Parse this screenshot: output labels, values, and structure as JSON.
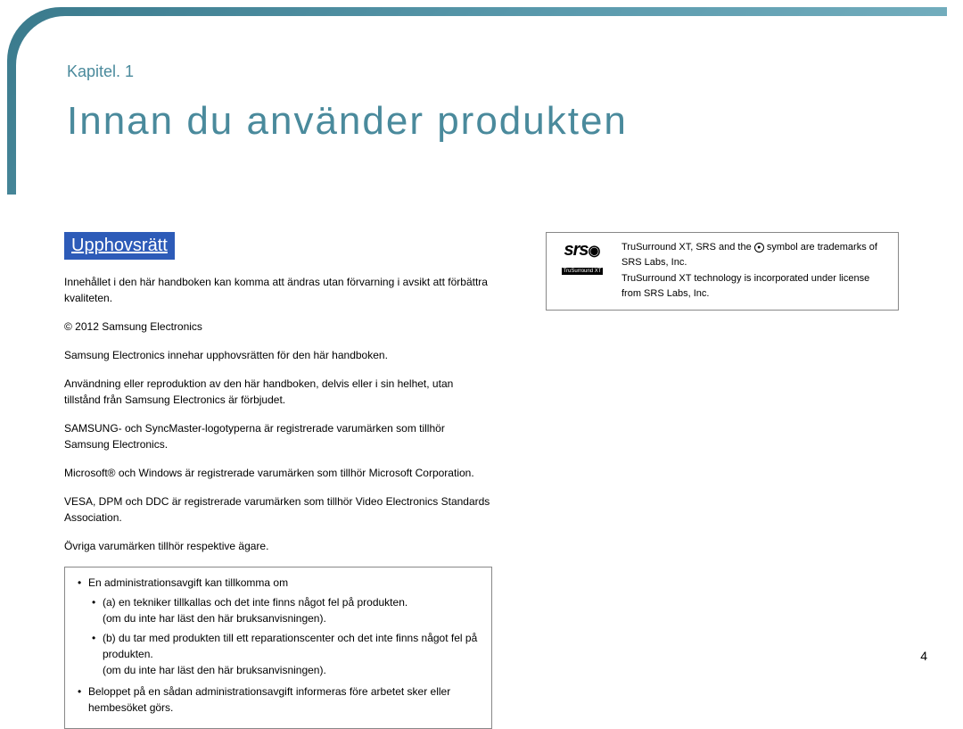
{
  "chapter_label": "Kapitel. 1",
  "page_title": "Innan du använder produkten",
  "section_heading": "Upphovsrätt",
  "paragraphs": {
    "p1": "Innehållet i den här handboken kan komma att ändras utan förvarning i avsikt att förbättra kvaliteten.",
    "p2": "© 2012 Samsung Electronics",
    "p3": "Samsung Electronics innehar upphovsrätten för den här handboken.",
    "p4": "Användning eller reproduktion av den här handboken, delvis eller i sin helhet, utan tillstånd från Samsung Electronics är förbjudet.",
    "p5": "SAMSUNG- och SyncMaster-logotyperna är registrerade varumärken som tillhör Samsung Electronics.",
    "p6": "Microsoft® och Windows är registrerade varumärken som tillhör Microsoft Corporation.",
    "p7": "VESA, DPM och DDC är registrerade varumärken som tillhör Video Electronics Standards Association.",
    "p8": "Övriga varumärken tillhör respektive ägare."
  },
  "note_box": {
    "item1": "En administrationsavgift kan tillkomma om",
    "sub_a": "(a) en tekniker tillkallas och det inte finns något fel på produkten.",
    "sub_a_extra": "(om du inte har läst den här bruksanvisningen).",
    "sub_b": "(b) du tar med produkten till ett reparationscenter och det inte finns något fel på produkten.",
    "sub_b_extra": "(om du inte har läst den här bruksanvisningen).",
    "item2": "Beloppet på en sådan administrationsavgift informeras före arbetet sker eller hembesöket görs."
  },
  "srs": {
    "logo_main": "srs",
    "logo_sub": "TruSurround XT",
    "line1_pre": "TruSurround XT, SRS and the ",
    "line1_post": " symbol are trademarks of SRS Labs, Inc.",
    "line2": "TruSurround XT technology is incorporated under license from SRS Labs, Inc."
  },
  "page_number": "4"
}
